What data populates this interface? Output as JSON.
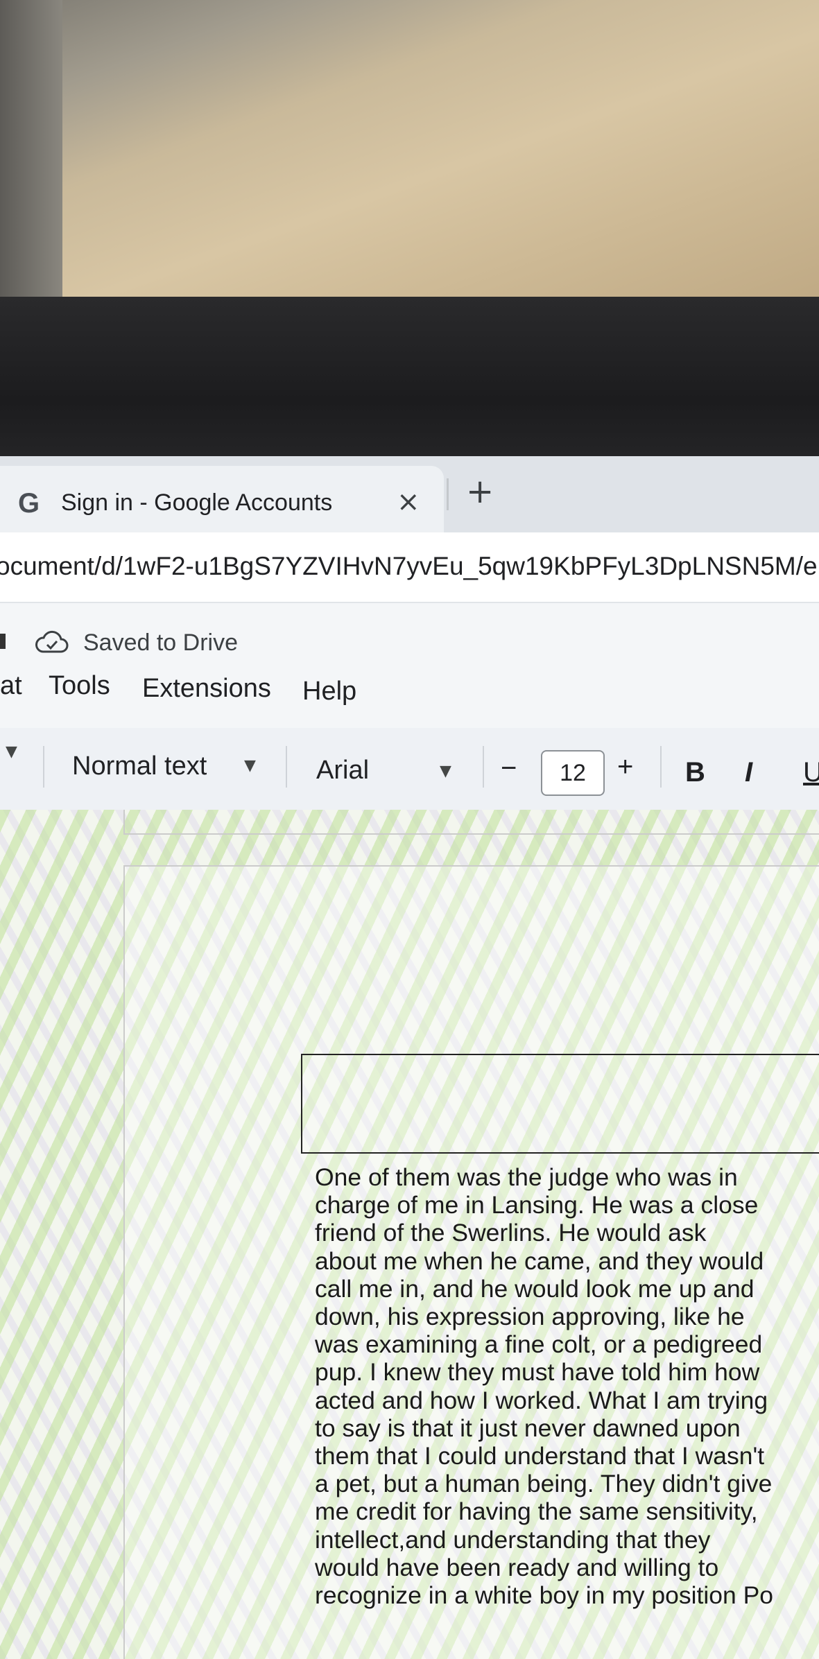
{
  "browser": {
    "tab": {
      "icon": "google-g-icon",
      "title": "Sign in - Google Accounts",
      "close_glyph": "×"
    },
    "new_tab_glyph": "+",
    "url": "ocument/d/1wF2-u1BgS7YZVIHvN7yvEu_5qw19KbPFyL3DpLNSN5M/e"
  },
  "docs": {
    "status": {
      "icon": "cloud-check-icon",
      "text": "Saved to Drive"
    },
    "menu": [
      "at",
      "Tools",
      "Extensions",
      "Help"
    ],
    "toolbar": {
      "style": "Normal text",
      "font": "Arial",
      "minus": "−",
      "font_size": "12",
      "plus": "+",
      "bold": "B",
      "italic": "I",
      "underline": "U"
    },
    "document": {
      "lines": [
        "One of them was the judge who was in",
        "charge of me in Lansing. He was a close",
        "friend of the Swerlins. He would ask",
        "about me when he came, and they would",
        "call me in, and he would look me up and",
        "down, his expression approving, like he",
        "was examining a fine colt, or a pedigreed",
        "pup. I knew they must have told him how",
        "acted and how I worked. What I am trying",
        "to say is that it just never dawned upon",
        "them that I could understand that I wasn't",
        "a pet, but a human being. They didn't give",
        "me credit for having the same sensitivity,",
        "intellect,and understanding that they",
        "would have been ready and willing to",
        "recognize in a white boy in my position Po"
      ]
    }
  }
}
